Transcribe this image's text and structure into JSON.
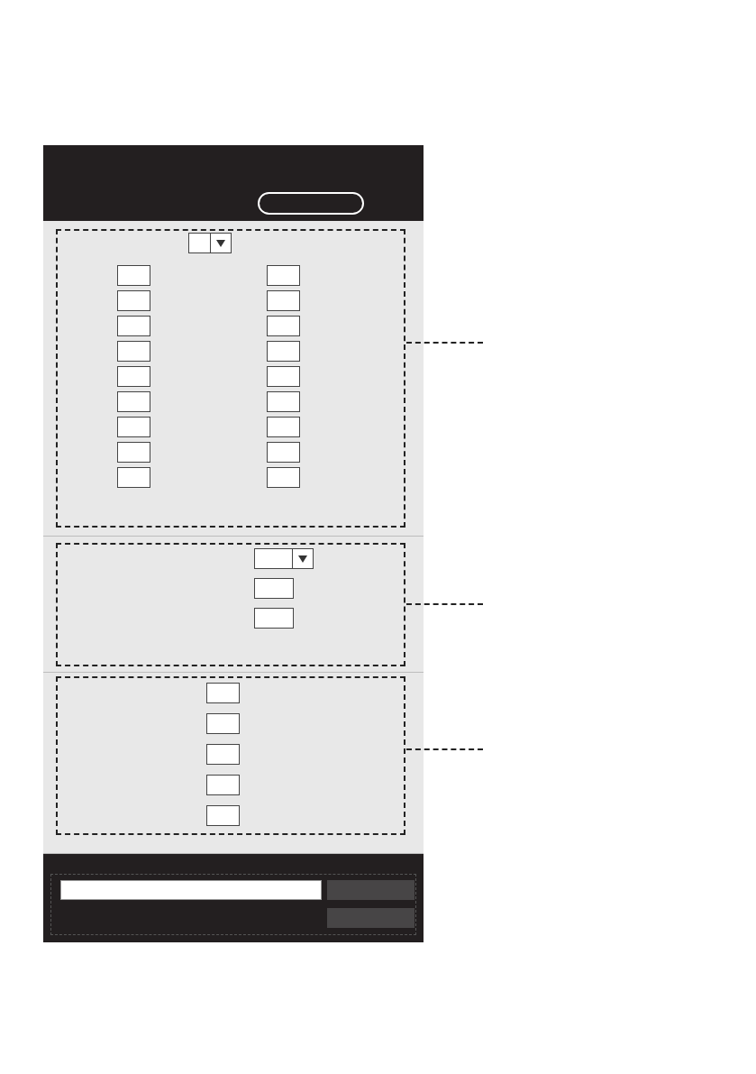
{
  "header": {
    "actions": [
      {
        "kind": "pill-button"
      }
    ]
  },
  "sections": [
    {
      "kind": "grid",
      "rows": [
        [
          {
            "kind": "dropdown"
          }
        ],
        [
          {
            "kind": "input"
          },
          {
            "kind": "input"
          }
        ],
        [
          {
            "kind": "input"
          },
          {
            "kind": "input"
          }
        ],
        [
          {
            "kind": "input"
          },
          {
            "kind": "input"
          }
        ],
        [
          {
            "kind": "input"
          },
          {
            "kind": "input"
          }
        ],
        [
          {
            "kind": "input"
          },
          {
            "kind": "input"
          }
        ],
        [
          {
            "kind": "input"
          },
          {
            "kind": "input"
          }
        ],
        [
          {
            "kind": "input"
          },
          {
            "kind": "input"
          }
        ],
        [
          {
            "kind": "input"
          },
          {
            "kind": "input"
          }
        ],
        [
          {
            "kind": "input"
          },
          {
            "kind": "input"
          }
        ]
      ]
    },
    {
      "kind": "stack-right",
      "rows": [
        [
          {
            "kind": "dropdown"
          }
        ],
        [
          {
            "kind": "input"
          }
        ],
        [
          {
            "kind": "input"
          }
        ]
      ]
    },
    {
      "kind": "stack-center",
      "rows": [
        [
          {
            "kind": "input"
          }
        ],
        [
          {
            "kind": "input"
          }
        ],
        [
          {
            "kind": "input"
          }
        ],
        [
          {
            "kind": "input"
          }
        ],
        [
          {
            "kind": "input"
          }
        ]
      ]
    }
  ],
  "footer": {
    "controls": [
      {
        "kind": "text-input"
      },
      {
        "kind": "button"
      },
      {
        "kind": "button"
      }
    ]
  }
}
